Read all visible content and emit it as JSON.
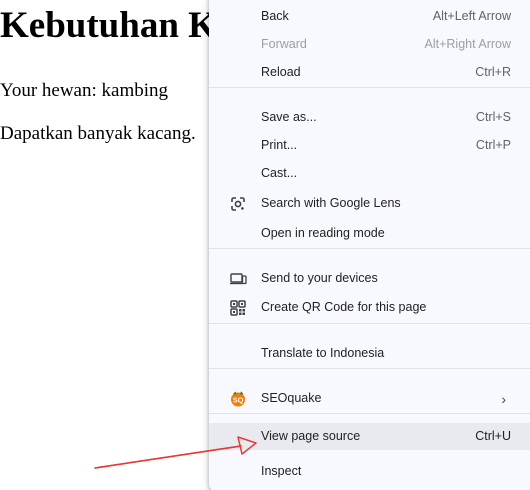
{
  "page": {
    "heading": "Kebutuhan K",
    "pet_line": "Your hewan: kambing",
    "beans_line": "Dapatkan banyak kacang."
  },
  "menu": {
    "back": {
      "label": "Back",
      "shortcut": "Alt+Left Arrow"
    },
    "forward": {
      "label": "Forward",
      "shortcut": "Alt+Right Arrow"
    },
    "reload": {
      "label": "Reload",
      "shortcut": "Ctrl+R"
    },
    "save_as": {
      "label": "Save as...",
      "shortcut": "Ctrl+S"
    },
    "print": {
      "label": "Print...",
      "shortcut": "Ctrl+P"
    },
    "cast": {
      "label": "Cast..."
    },
    "lens": {
      "label": "Search with Google Lens",
      "icon": "google-lens-icon"
    },
    "reading": {
      "label": "Open in reading mode"
    },
    "send_devices": {
      "label": "Send to your devices",
      "icon": "devices-icon"
    },
    "qr": {
      "label": "Create QR Code for this page",
      "icon": "qr-code-icon"
    },
    "translate": {
      "label": "Translate to Indonesia"
    },
    "seoquake": {
      "label": "SEOquake",
      "icon": "seoquake-icon"
    },
    "view_source": {
      "label": "View page source",
      "shortcut": "Ctrl+U"
    },
    "inspect": {
      "label": "Inspect"
    }
  },
  "colors": {
    "menu_bg": "#f8f9fe",
    "hover_bg": "#e9eaef",
    "annotation_arrow": "#e53935",
    "seoquake_orange": "#f57c00"
  }
}
